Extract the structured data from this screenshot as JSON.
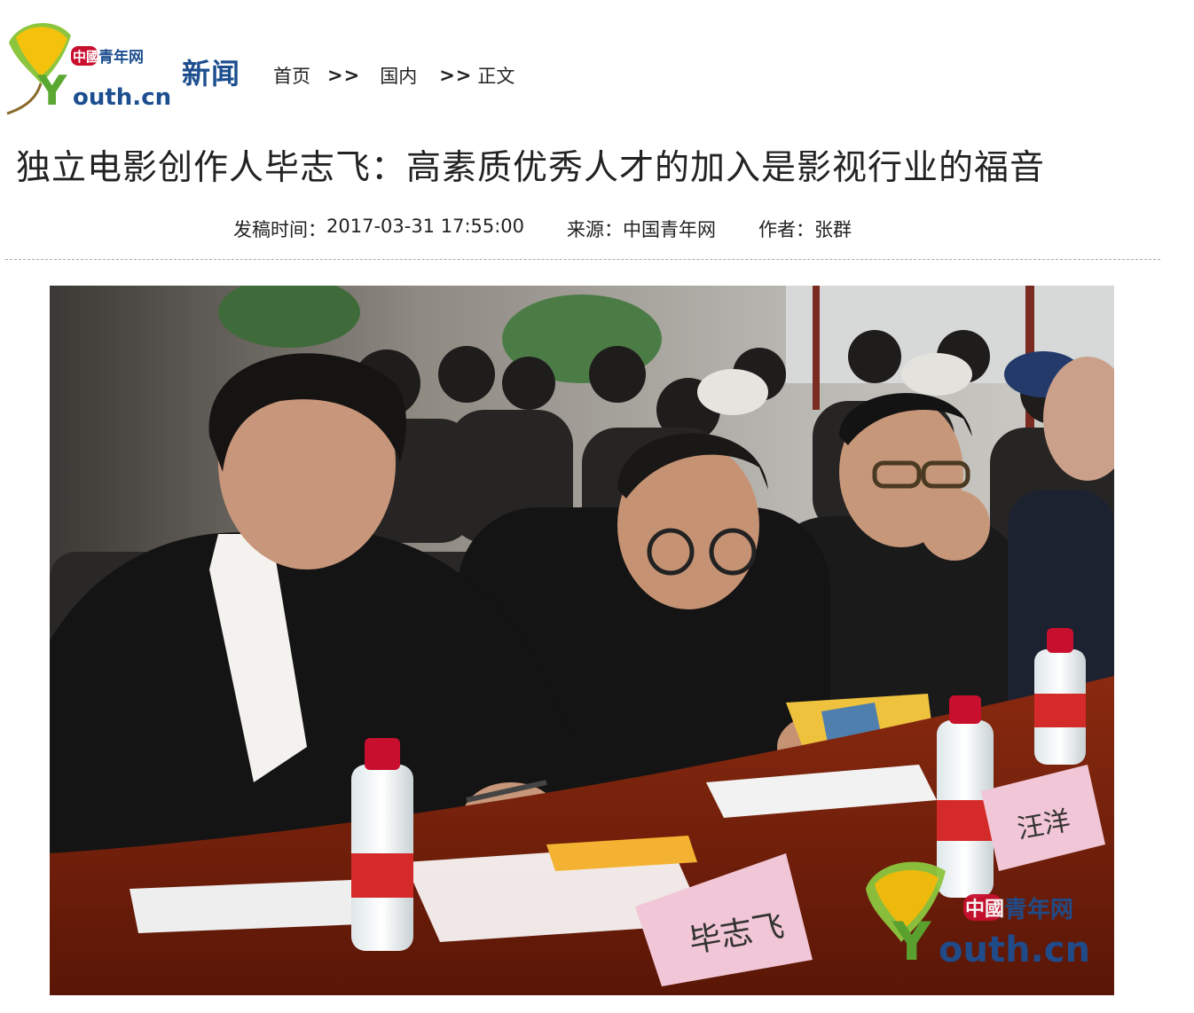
{
  "header": {
    "logo_cn": "中國青年网",
    "logo_en": "outh.cn",
    "logo_y": "Y",
    "section": "新闻",
    "breadcrumb": [
      {
        "label": "首页"
      },
      {
        "label": "国内"
      },
      {
        "label": "正文"
      }
    ],
    "breadcrumb_separator": ">>"
  },
  "article": {
    "title": "独立电影创作人毕志飞：高素质优秀人才的加入是影视行业的福音",
    "meta": {
      "published_label": "发稿时间：",
      "published_value": "2017-03-31 17:55:00",
      "source_label": "来源：",
      "source_value": "中国青年网",
      "author_label": "作者：",
      "author_value": "张群"
    }
  },
  "photo": {
    "nameplate_left": "毕志飞",
    "nameplate_right": "汪洋",
    "watermark_cn": "中國青年网",
    "watermark_en": "outh.cn",
    "watermark_y": "Y"
  },
  "colors": {
    "brand_blue": "#1d4e8f",
    "brand_red": "#c8102e",
    "ginkgo_yellow": "#f4c20d",
    "ginkgo_green": "#5aa832"
  }
}
